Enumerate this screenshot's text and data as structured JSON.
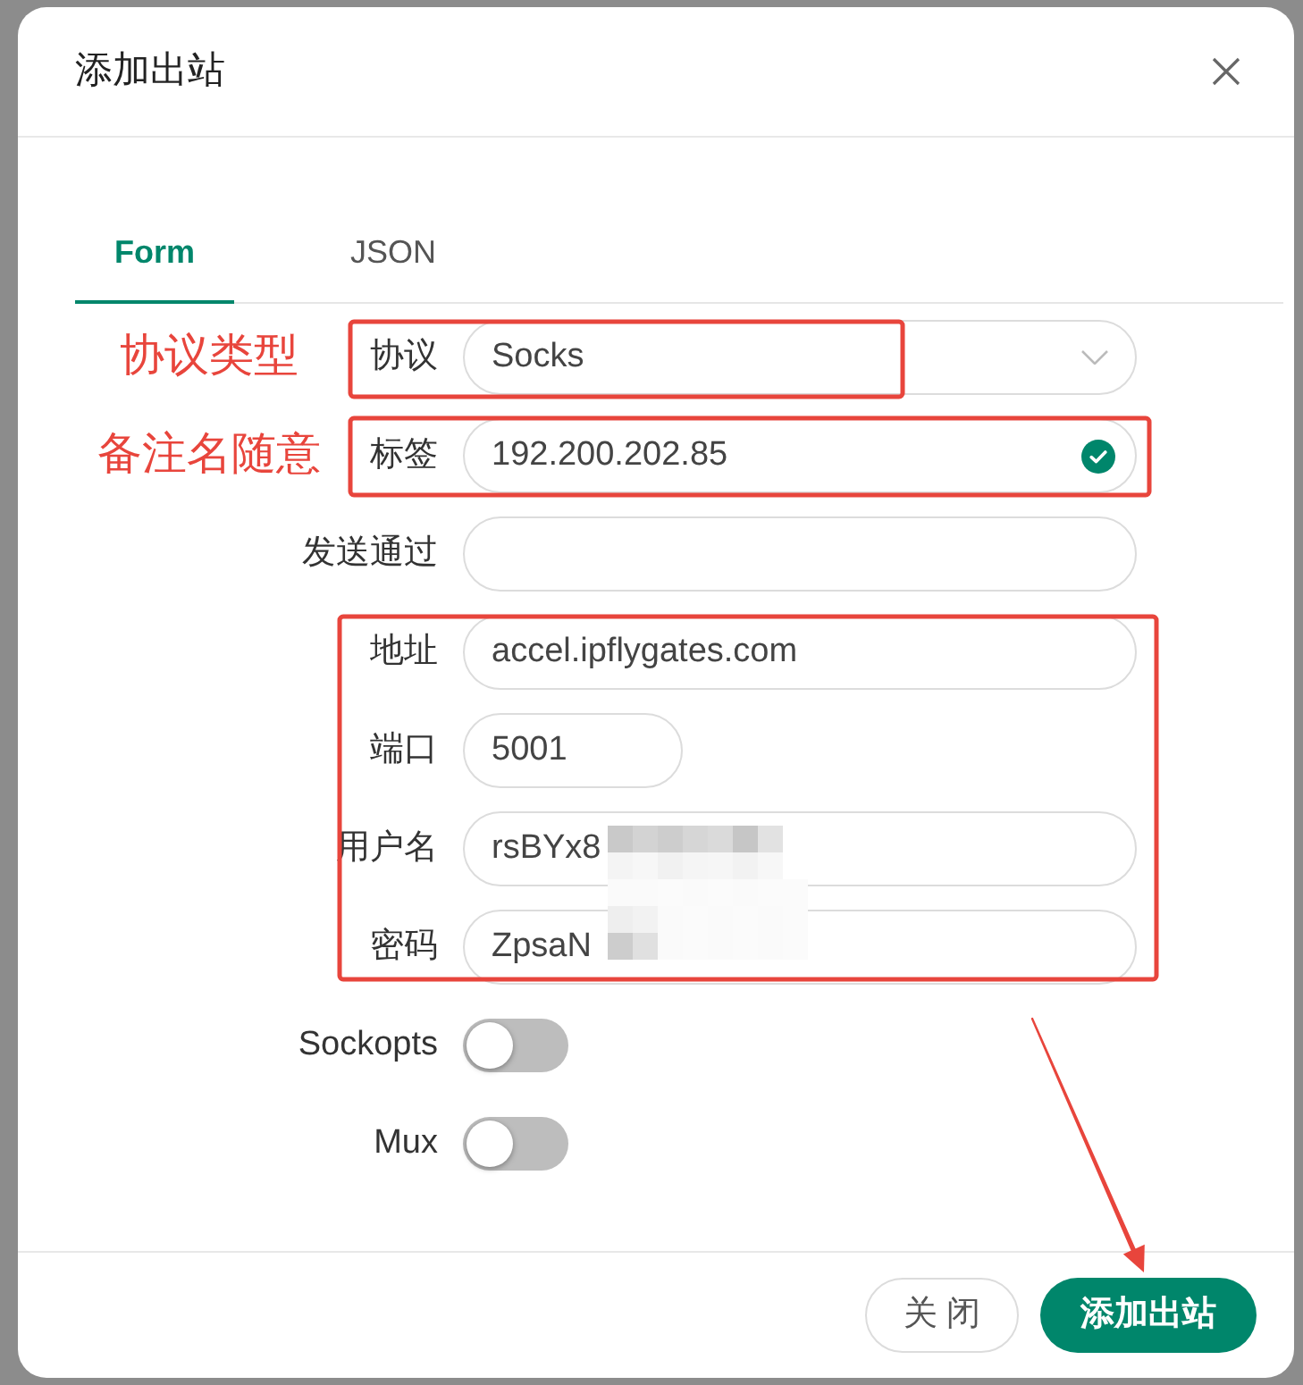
{
  "dialog": {
    "title": "添加出站"
  },
  "tabs": [
    {
      "label": "Form",
      "selected": true
    },
    {
      "label": "JSON",
      "selected": false
    }
  ],
  "form": {
    "fields": [
      {
        "kind": "select",
        "label": "协议",
        "value": "Socks",
        "note": "协议类型"
      },
      {
        "kind": "text",
        "label": "标签",
        "value": "192.200.202.85",
        "valid": true,
        "note": "备注名随意"
      },
      {
        "kind": "text",
        "label": "发送通过",
        "valid": false
      },
      {
        "kind": "text",
        "label": "地址",
        "value": "accel.ipflygates.com",
        "valid": false
      },
      {
        "kind": "number",
        "label": "端口",
        "value": "5001",
        "valid": false
      },
      {
        "kind": "text",
        "label": "用户名",
        "value": "rsBYx8",
        "valid": false
      },
      {
        "kind": "text",
        "label": "密码",
        "value": "ZpsaN",
        "valid": false
      },
      {
        "kind": "switch",
        "label": "Sockopts",
        "on": false
      },
      {
        "kind": "switch",
        "label": "Mux",
        "on": false
      }
    ]
  },
  "footer": {
    "buttons": [
      {
        "label": "关 闭",
        "kind": "secondary"
      },
      {
        "label": "添加出站",
        "kind": "primary"
      }
    ]
  }
}
